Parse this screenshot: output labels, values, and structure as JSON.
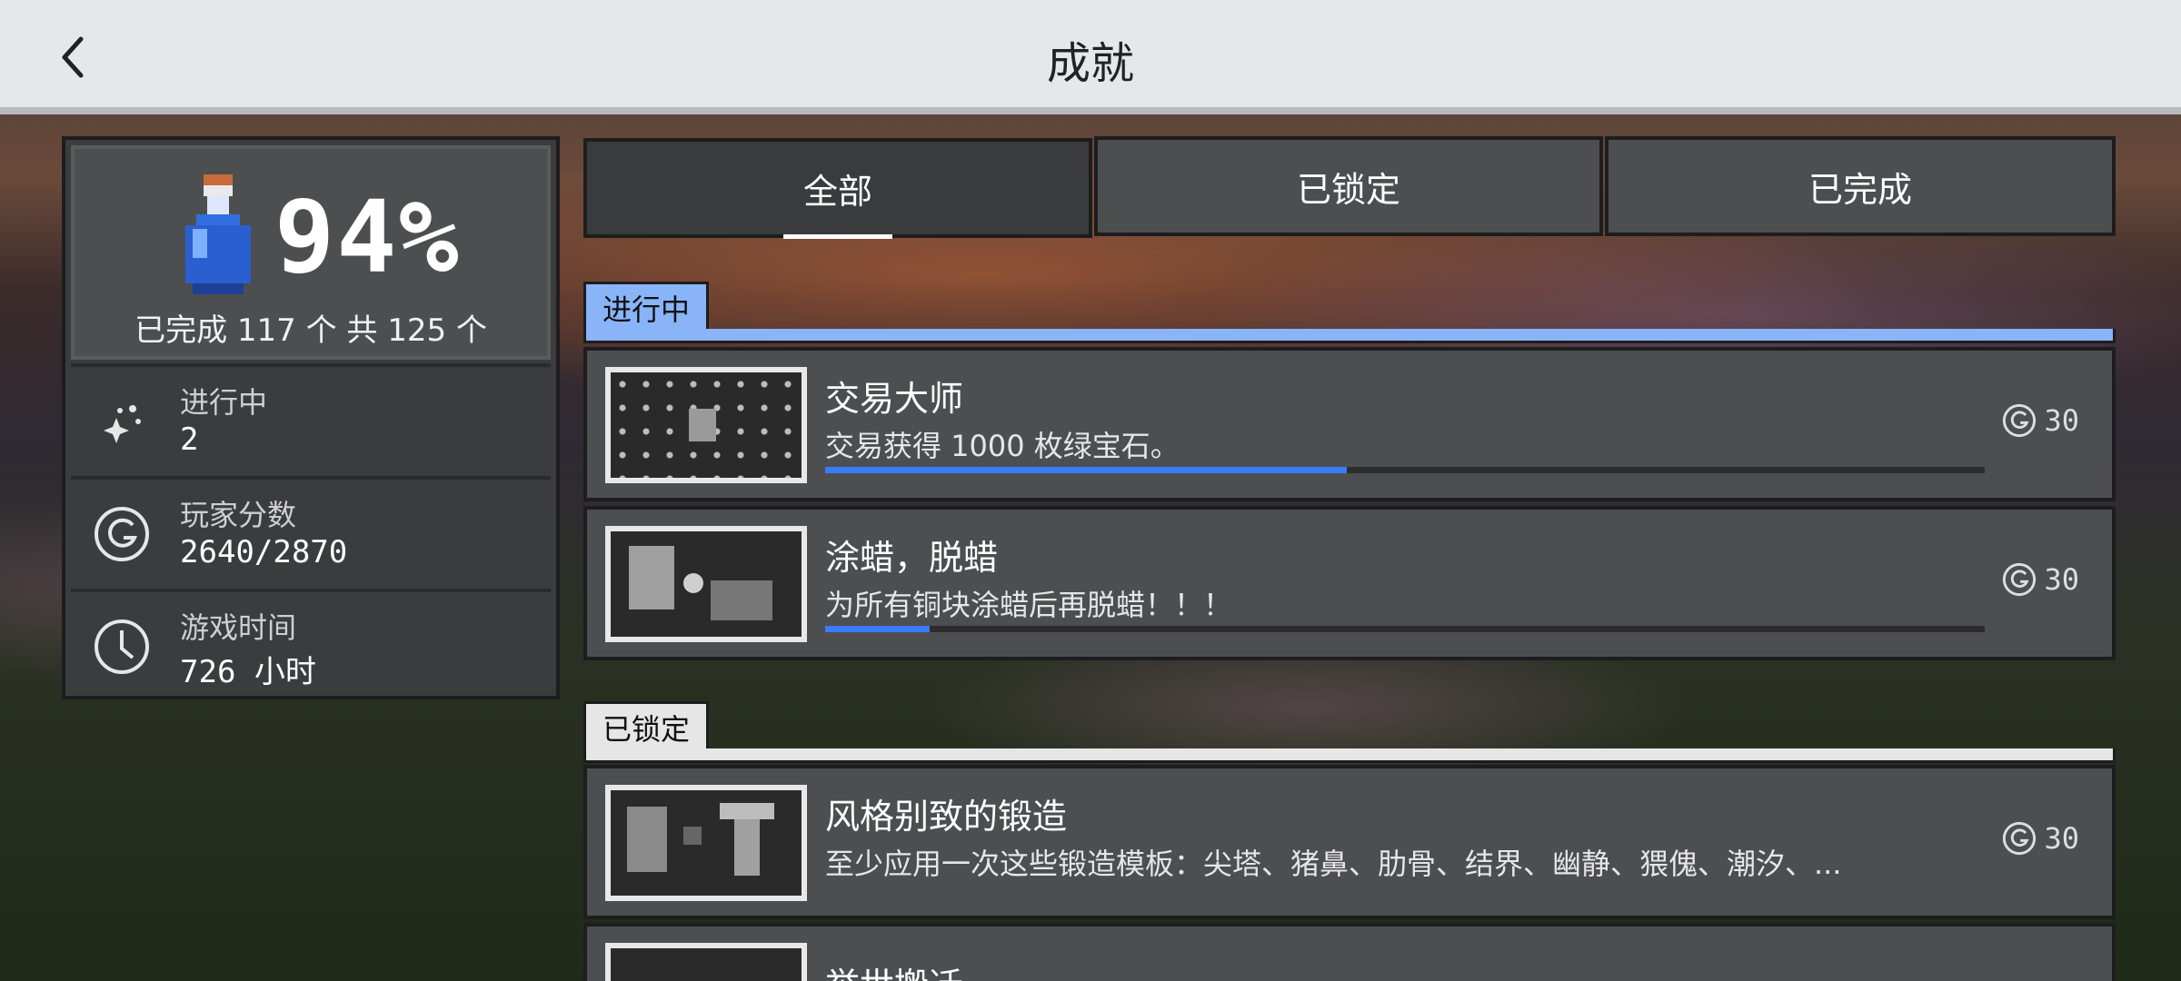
{
  "header": {
    "title": "成就",
    "back_icon": "chevron-left-icon"
  },
  "summary": {
    "percent": "94%",
    "completed_text": "已完成 117 个 共 125 个",
    "stats": [
      {
        "label": "进行中",
        "value": "2",
        "icon": "sparkles-icon"
      },
      {
        "label": "玩家分数",
        "value": "2640/2870",
        "icon": "gamerscore-icon"
      },
      {
        "label": "游戏时间",
        "value": "726 小时",
        "icon": "clock-icon"
      }
    ]
  },
  "tabs": [
    {
      "label": "全部",
      "active": true
    },
    {
      "label": "已锁定",
      "active": false
    },
    {
      "label": "已完成",
      "active": false
    }
  ],
  "sections": {
    "in_progress": {
      "label": "进行中",
      "color": "#8ab4f8"
    },
    "locked": {
      "label": "已锁定",
      "color": "#e6e6e6"
    }
  },
  "achievements": [
    {
      "title": "交易大师",
      "description": "交易获得 1000 枚绿宝石。",
      "score": "30",
      "progress": 0.45
    },
    {
      "title": "涂蜡，脱蜡",
      "description": "为所有铜块涂蜡后再脱蜡！！！",
      "score": "30",
      "progress": 0.09
    },
    {
      "title": "风格别致的锻造",
      "description": "至少应用一次这些锻造模板：尖塔、猪鼻、肋骨、结界、幽静、猥傀、潮汐、...",
      "score": "30"
    },
    {
      "title": "举世搬迁"
    }
  ]
}
